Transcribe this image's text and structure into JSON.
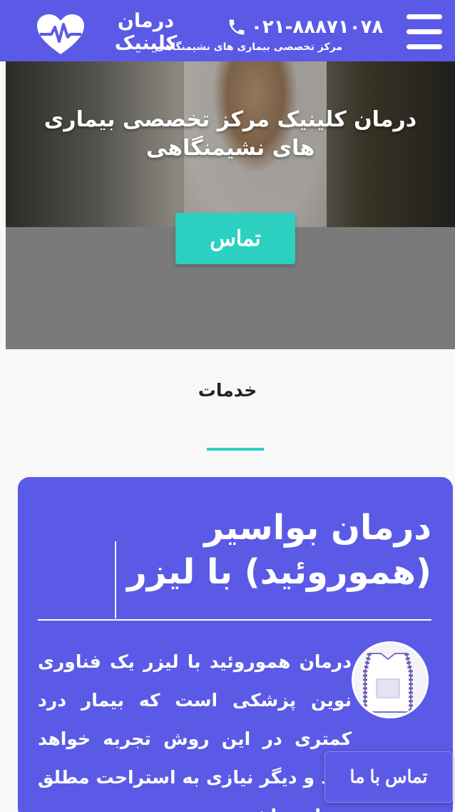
{
  "header": {
    "brand_name": "درمان کلینیک",
    "brand_tagline": "مرکز تخصصی بیماری های نشیمنگاهی",
    "phone": "۰۲۱-۸۸۸۷۱۰۷۸",
    "menu_icon": "hamburger-icon",
    "phone_icon": "phone-icon",
    "logo_icon": "heart-pulse-icon"
  },
  "hero": {
    "title": "درمان کلینیک مرکز تخصصی بیماری های نشیمنگاهی",
    "cta_label": "تماس"
  },
  "services": {
    "title": "خدمات"
  },
  "card": {
    "title": "درمان بواسیر (هموروئید) با لیزر",
    "body": "درمان هموروئید با لیزر یک فناوری نوین پزشکی است که بیمار درد کمتری در این روش تجربه خواهد کرد و دیگر نیازی به استراحت مطلق نخواهد داشت"
  },
  "floating": {
    "contact_label": "تماس با ما"
  },
  "colors": {
    "primary": "#5a5ae6",
    "accent": "#2bd0c0"
  }
}
